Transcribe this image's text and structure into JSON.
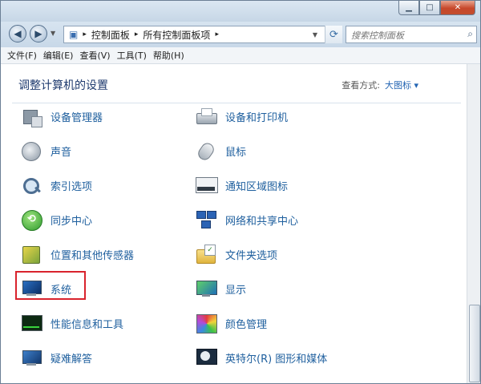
{
  "address": {
    "crumbs": [
      "控制面板",
      "所有控制面板项"
    ],
    "search_placeholder": "搜索控制面板"
  },
  "menu": [
    "文件(F)",
    "编辑(E)",
    "查看(V)",
    "工具(T)",
    "帮助(H)"
  ],
  "content": {
    "heading": "调整计算机的设置",
    "view_label": "查看方式:",
    "view_value": "大图标 ▾"
  },
  "items": [
    {
      "label": "设备管理器",
      "icon": "device-manager-icon"
    },
    {
      "label": "设备和打印机",
      "icon": "printer-icon"
    },
    {
      "label": "声音",
      "icon": "speaker-icon"
    },
    {
      "label": "鼠标",
      "icon": "mouse-icon"
    },
    {
      "label": "索引选项",
      "icon": "index-options-icon"
    },
    {
      "label": "通知区域图标",
      "icon": "notification-tray-icon"
    },
    {
      "label": "同步中心",
      "icon": "sync-icon"
    },
    {
      "label": "网络和共享中心",
      "icon": "network-icon"
    },
    {
      "label": "位置和其他传感器",
      "icon": "sensor-icon"
    },
    {
      "label": "文件夹选项",
      "icon": "folder-options-icon"
    },
    {
      "label": "系统",
      "icon": "system-icon"
    },
    {
      "label": "显示",
      "icon": "display-icon"
    },
    {
      "label": "性能信息和工具",
      "icon": "performance-icon"
    },
    {
      "label": "颜色管理",
      "icon": "color-management-icon"
    },
    {
      "label": "疑难解答",
      "icon": "troubleshooting-icon"
    },
    {
      "label": "英特尔(R) 图形和媒体",
      "icon": "intel-graphics-icon"
    }
  ]
}
